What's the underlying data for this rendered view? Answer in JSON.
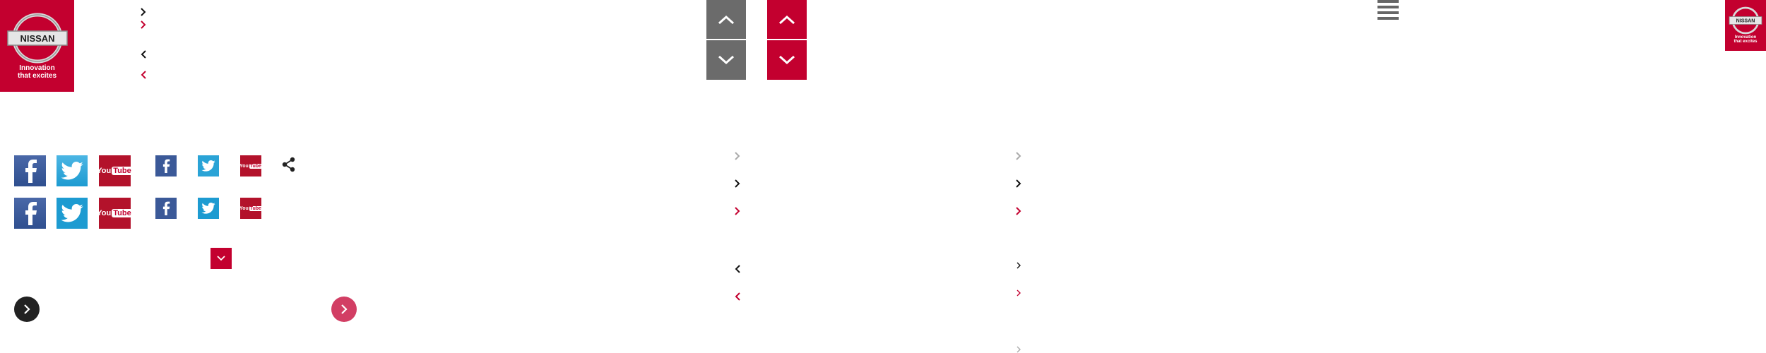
{
  "colors": {
    "brand_red": "#c3002f",
    "grey_button": "#6b6b6b",
    "facebook": "#3b5998",
    "twitter": "#1d9bd1",
    "youtube": "#b3122b",
    "dark": "#222222",
    "pink": "#d23e64"
  },
  "logo": {
    "wordmark": "NISSAN",
    "tagline_line1": "Innovation",
    "tagline_line2": "that excites"
  },
  "logo_small": {
    "wordmark": "NISSAN",
    "tagline_line1": "Innovation",
    "tagline_line2": "that excites"
  },
  "social": {
    "youtube_text_you": "You",
    "youtube_text_tube": "Tube"
  },
  "icons": [
    "chevron-right-icon",
    "chevron-left-icon",
    "chevron-up-icon",
    "chevron-down-icon",
    "hamburger-menu-icon",
    "share-icon",
    "facebook-icon",
    "twitter-icon",
    "youtube-icon"
  ]
}
